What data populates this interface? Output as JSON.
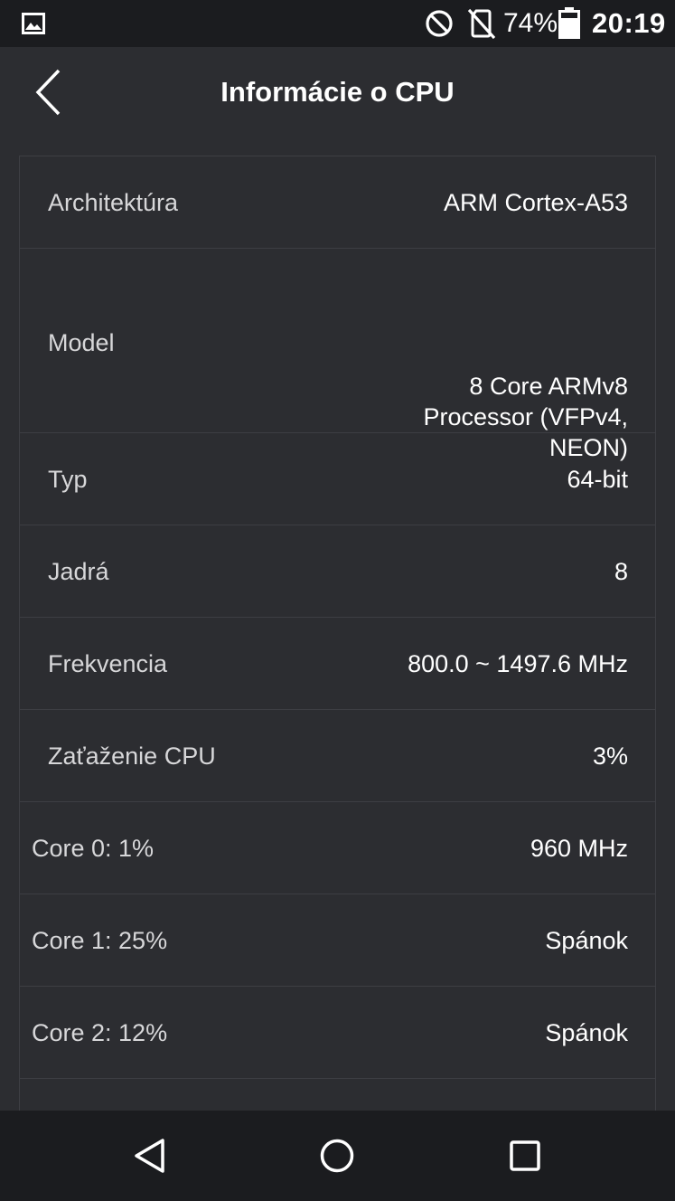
{
  "status_bar": {
    "icons": [
      "gallery-icon",
      "do-not-disturb-icon",
      "no-sim-icon",
      "battery-icon"
    ],
    "battery_percent": "74%",
    "battery_level": 0.74,
    "time": "20:19"
  },
  "app_bar": {
    "back_icon": "chevron-left-icon",
    "title": "Informácie o CPU"
  },
  "cpu_info": {
    "rows": [
      {
        "label": "Architektúra",
        "value": "ARM Cortex-A53"
      },
      {
        "label": "Model",
        "value_lines": [
          "8 Core ARMv8",
          "Processor (VFPv4,",
          "NEON)"
        ]
      },
      {
        "label": "Typ",
        "value": "64-bit"
      },
      {
        "label": "Jadrá",
        "value": "8"
      },
      {
        "label": "Frekvencia",
        "value": "800.0 ~ 1497.6 MHz"
      },
      {
        "label": "Zaťaženie CPU",
        "value": "3%"
      }
    ],
    "cores": [
      {
        "label": "Core 0: 1%",
        "value": "960 MHz"
      },
      {
        "label": "Core 1: 25%",
        "value": "Spánok"
      },
      {
        "label": "Core 2: 12%",
        "value": "Spánok"
      }
    ]
  },
  "nav_bar": {
    "buttons": [
      "nav-back-icon",
      "nav-home-icon",
      "nav-recents-icon"
    ]
  },
  "colors": {
    "background": "#2c2d31",
    "bars": "#1b1c1f",
    "divider": "#3d3e43",
    "label_text": "#d7d7d9",
    "value_text": "#ffffff"
  }
}
